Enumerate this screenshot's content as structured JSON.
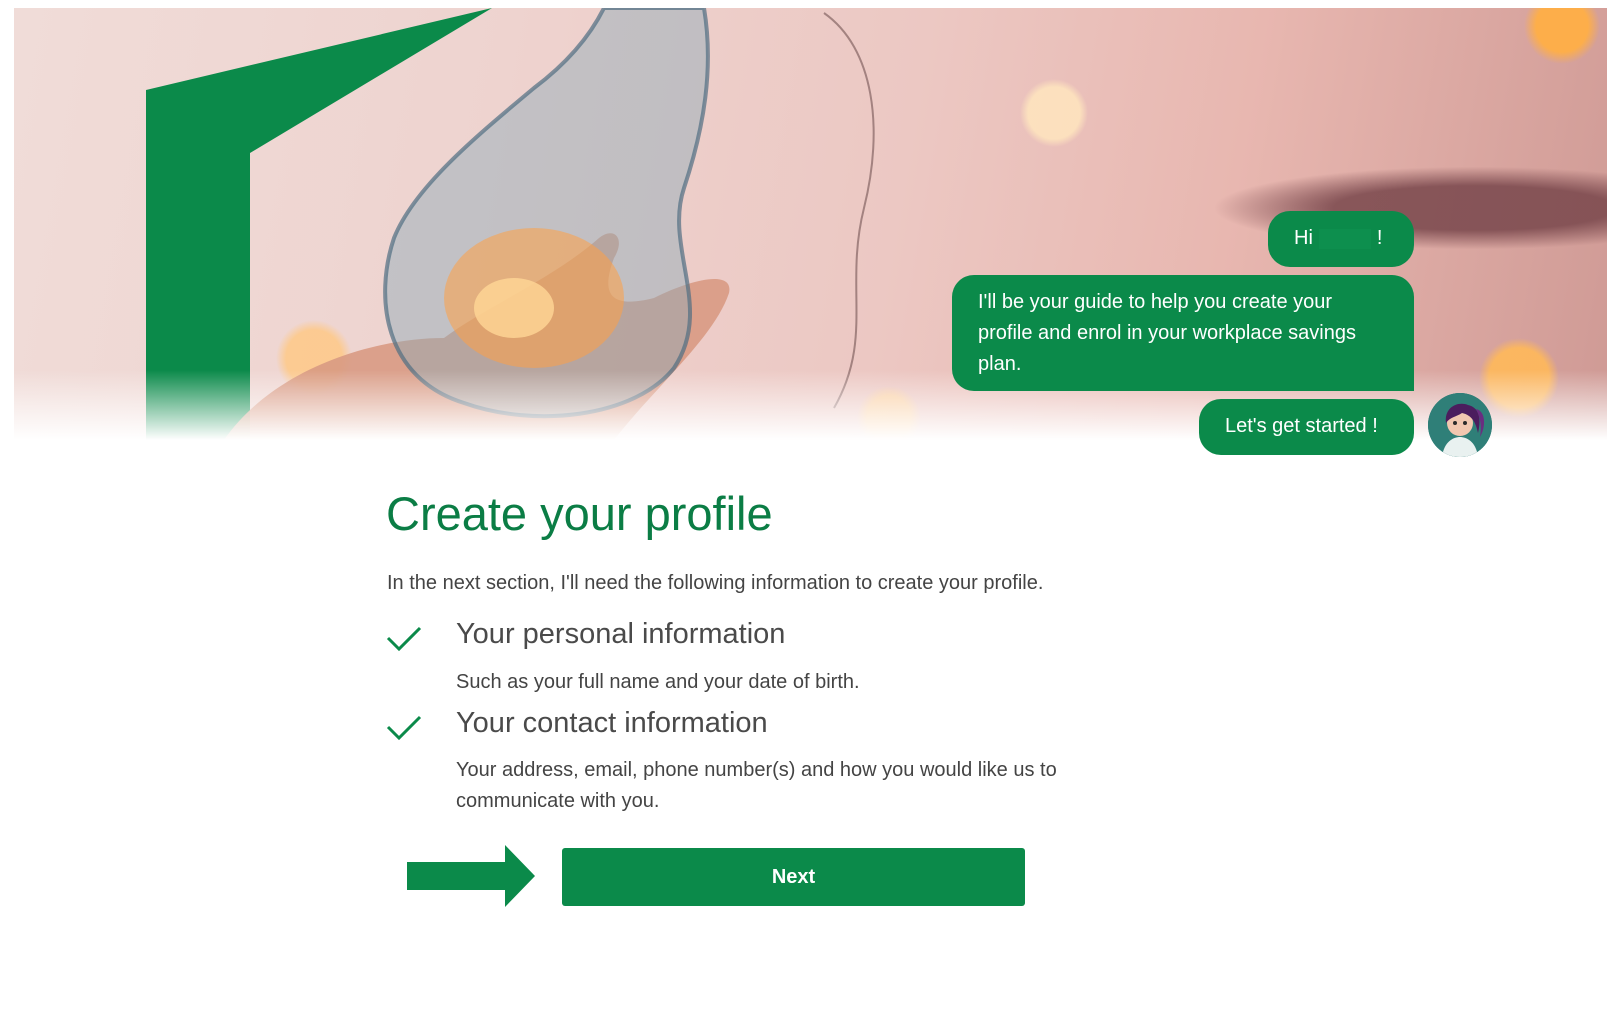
{
  "colors": {
    "brand_green": "#0b8a4a",
    "title_green": "#0b7d45",
    "text_gray": "#444444"
  },
  "hero": {
    "image": "lightbulb-with-fairy-lights-photo",
    "decoration": "green-chevron-shape"
  },
  "chat": {
    "greeting_prefix": "Hi",
    "greeting_suffix": "!",
    "guide_message": "I'll be your guide to help you create your profile and enrol in your workplace savings plan.",
    "start_message": "Let's get started !",
    "avatar_icon": "assistant-avatar-icon"
  },
  "main": {
    "title": "Create your profile",
    "intro": "In the next section, I'll need the following information to create your profile.",
    "items": [
      {
        "icon": "checkmark-icon",
        "title": "Your personal information",
        "description": "Such as your full name and your date of birth."
      },
      {
        "icon": "checkmark-icon",
        "title": "Your contact information",
        "description": "Your address, email, phone number(s) and how you would like us to communicate with you."
      }
    ],
    "next_label": "Next",
    "arrow_icon": "right-arrow-icon"
  }
}
